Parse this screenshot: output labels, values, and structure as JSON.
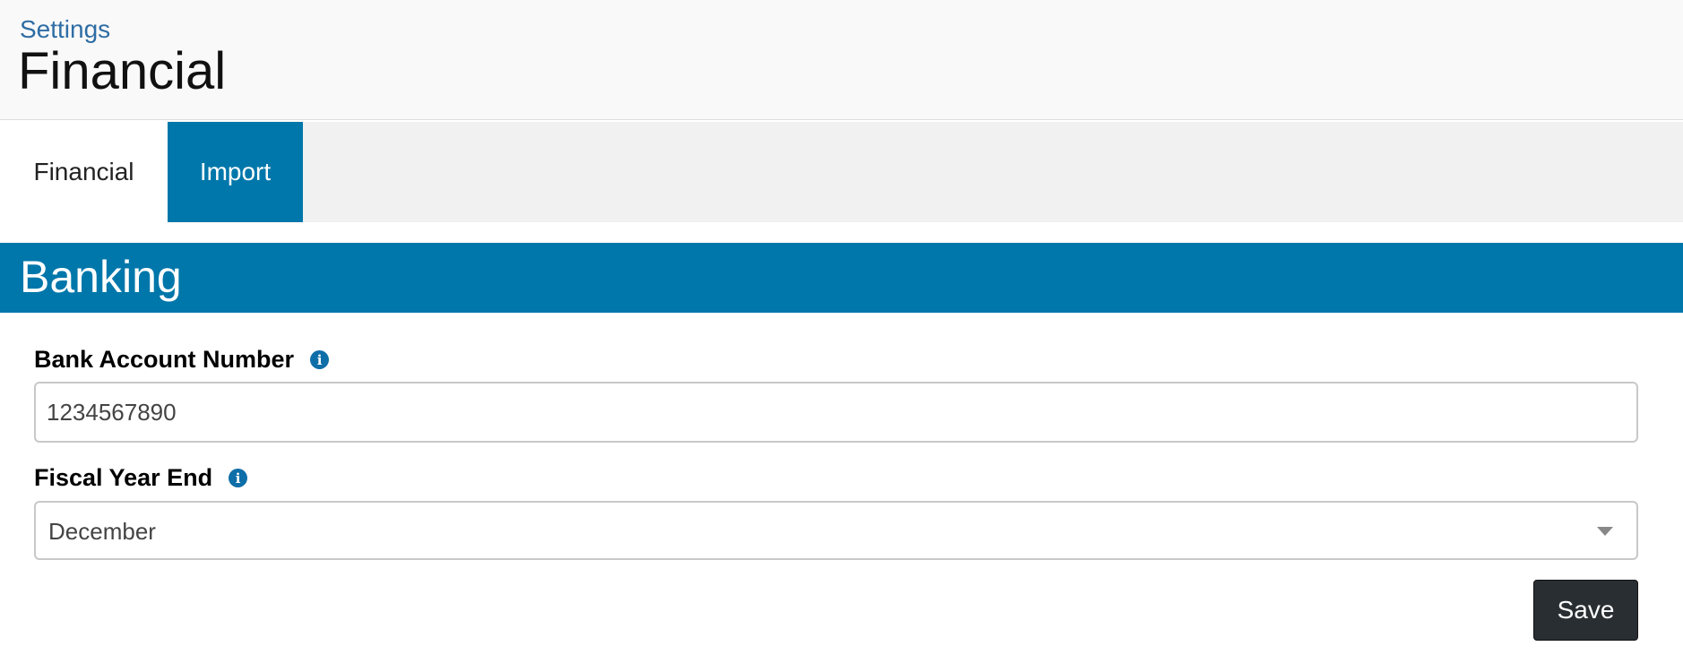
{
  "header": {
    "breadcrumb": "Settings",
    "title": "Financial"
  },
  "tabs": [
    {
      "label": "Financial",
      "active": true
    },
    {
      "label": "Import",
      "active": false
    }
  ],
  "section": {
    "title": "Banking"
  },
  "form": {
    "bank_account": {
      "label": "Bank Account Number",
      "value": "1234567890",
      "icon": "info-icon"
    },
    "fiscal_year_end": {
      "label": "Fiscal Year End",
      "selected": "December",
      "icon": "info-icon"
    },
    "save_label": "Save"
  },
  "colors": {
    "accent": "#0077aa",
    "header_bg": "#f9f9f9",
    "tabbar_bg": "#f1f1f1",
    "button_bg": "#292e33",
    "link": "#2e6da4"
  }
}
